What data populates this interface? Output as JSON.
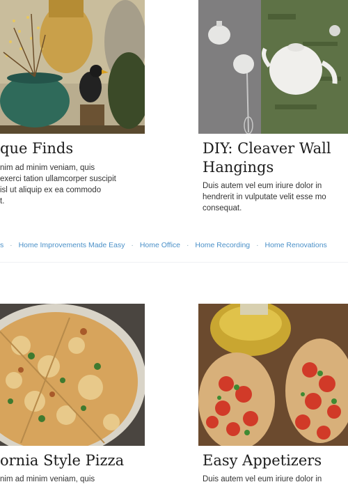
{
  "cards": [
    {
      "title": "que Finds",
      "lines": [
        "nim ad minim veniam, quis",
        "exerci tation ullamcorper suscipit",
        "isl ut aliquip ex ea commodo",
        "t."
      ]
    },
    {
      "title_line1": "DIY: Cleaver Wall",
      "title_line2": "Hangings",
      "lines": [
        "Duis autem vel eum iriure dolor in",
        "hendrerit in vulputate velit esse mo",
        "consequat."
      ]
    },
    {
      "title": "ornia Style Pizza",
      "lines": [
        "nim ad minim veniam, quis"
      ]
    },
    {
      "title": "Easy Appetizers",
      "lines": [
        "Duis autem vel eum iriure dolor in"
      ]
    }
  ],
  "tags": {
    "lead": "s",
    "items": [
      "Home Improvements Made Easy",
      "Home Office",
      "Home Recording",
      "Home Renovations"
    ],
    "separator": "·"
  },
  "colors": {
    "link": "#4a90c8",
    "title": "#1c1c1c"
  }
}
